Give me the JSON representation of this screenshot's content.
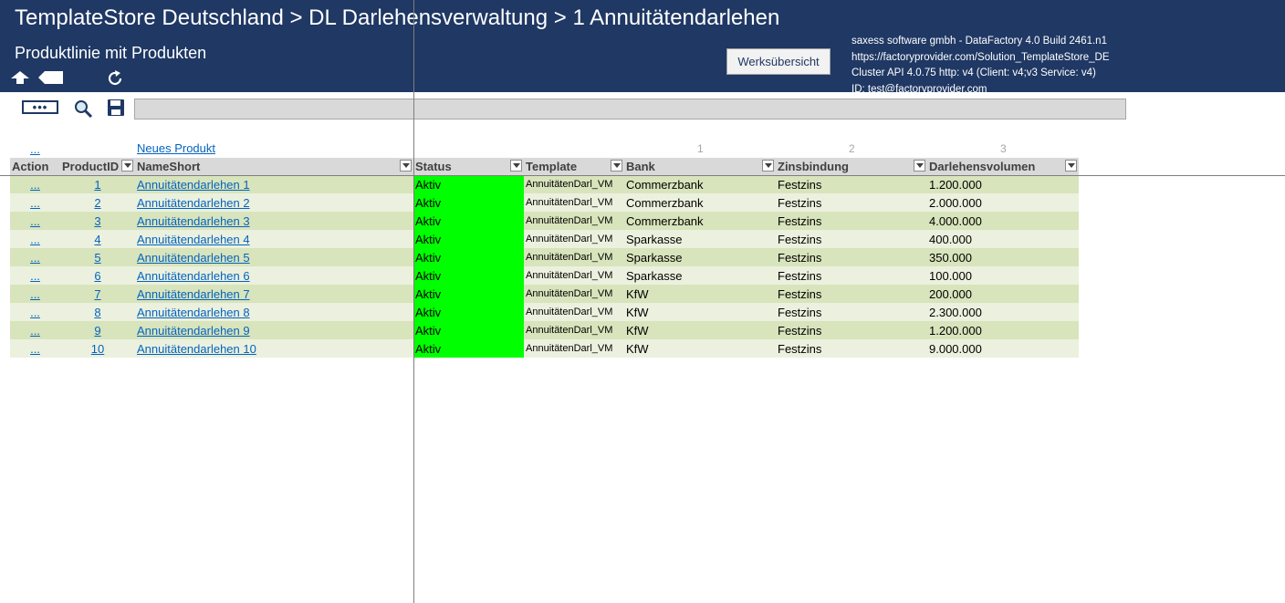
{
  "header": {
    "title": "TemplateStore Deutschland > DL  Darlehensverwaltung > 1  Annuitätendarlehen",
    "subtitle": "Produktlinie mit Produkten",
    "werks_button": "Werksübersicht",
    "info": [
      "saxess software gmbh - DataFactory 4.0 Build 2461.n1",
      "https://factoryprovider.com/Solution_TemplateStore_DE",
      "Cluster API 4.0.75 http: v4 (Client: v4;v3 Service: v4)",
      "ID: test@factoryprovider.com"
    ]
  },
  "toolbar": {
    "more_label": "•••",
    "formula_value": ""
  },
  "sheet": {
    "top_action_link": "...",
    "new_product_link": "Neues Produkt",
    "column_numbers": [
      "1",
      "2",
      "3"
    ],
    "headers": [
      "Action",
      "ProductID",
      "NameShort",
      "Status",
      "Template",
      "Bank",
      "Zinsbindung",
      "Darlehensvolumen"
    ],
    "rows": [
      {
        "action": "...",
        "id": "1",
        "name": "Annuitätendarlehen 1",
        "status": "Aktiv",
        "template": "AnnuitätenDarl_VM",
        "bank": "Commerzbank",
        "zins": "Festzins",
        "volumen": "1.200.000"
      },
      {
        "action": "...",
        "id": "2",
        "name": "Annuitätendarlehen 2",
        "status": "Aktiv",
        "template": "AnnuitätenDarl_VM",
        "bank": "Commerzbank",
        "zins": "Festzins",
        "volumen": "2.000.000"
      },
      {
        "action": "...",
        "id": "3",
        "name": "Annuitätendarlehen 3",
        "status": "Aktiv",
        "template": "AnnuitätenDarl_VM",
        "bank": "Commerzbank",
        "zins": "Festzins",
        "volumen": "4.000.000"
      },
      {
        "action": "...",
        "id": "4",
        "name": "Annuitätendarlehen 4",
        "status": "Aktiv",
        "template": "AnnuitätenDarl_VM",
        "bank": "Sparkasse",
        "zins": "Festzins",
        "volumen": "400.000"
      },
      {
        "action": "...",
        "id": "5",
        "name": "Annuitätendarlehen 5",
        "status": "Aktiv",
        "template": "AnnuitätenDarl_VM",
        "bank": "Sparkasse",
        "zins": "Festzins",
        "volumen": "350.000"
      },
      {
        "action": "...",
        "id": "6",
        "name": "Annuitätendarlehen 6",
        "status": "Aktiv",
        "template": "AnnuitätenDarl_VM",
        "bank": "Sparkasse",
        "zins": "Festzins",
        "volumen": "100.000"
      },
      {
        "action": "...",
        "id": "7",
        "name": "Annuitätendarlehen 7",
        "status": "Aktiv",
        "template": "AnnuitätenDarl_VM",
        "bank": "KfW",
        "zins": "Festzins",
        "volumen": "200.000"
      },
      {
        "action": "...",
        "id": "8",
        "name": "Annuitätendarlehen 8",
        "status": "Aktiv",
        "template": "AnnuitätenDarl_VM",
        "bank": "KfW",
        "zins": "Festzins",
        "volumen": "2.300.000"
      },
      {
        "action": "...",
        "id": "9",
        "name": "Annuitätendarlehen 9",
        "status": "Aktiv",
        "template": "AnnuitätenDarl_VM",
        "bank": "KfW",
        "zins": "Festzins",
        "volumen": "1.200.000"
      },
      {
        "action": "...",
        "id": "10",
        "name": "Annuitätendarlehen 10",
        "status": "Aktiv",
        "template": "AnnuitätenDarl_VM",
        "bank": "KfW",
        "zins": "Festzins",
        "volumen": "9.000.000"
      }
    ]
  },
  "colors": {
    "header_bg": "#1f3864",
    "status_active": "#00ff00",
    "row_odd": "#d8e4bc",
    "row_even": "#ebf1de",
    "link": "#0563c1"
  },
  "icons": [
    "home-arrow-icon",
    "back-tag-icon",
    "refresh-icon",
    "search-icon",
    "save-icon",
    "filter-dropdown-icon"
  ]
}
